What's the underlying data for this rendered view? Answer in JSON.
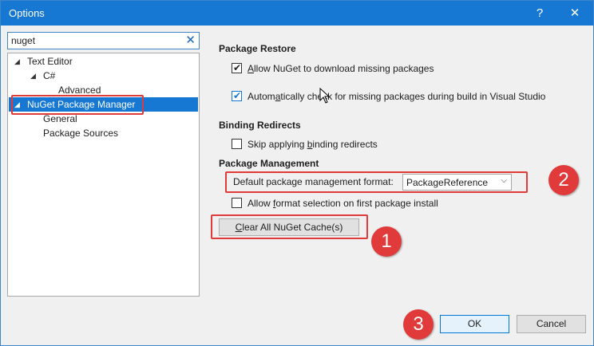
{
  "window": {
    "title": "Options",
    "help_glyph": "?",
    "close_glyph": "✕"
  },
  "search": {
    "value": "nuget",
    "clear_glyph": "✕"
  },
  "tree": {
    "items": [
      {
        "label": "Text Editor",
        "arrow": "◢"
      },
      {
        "label": "C#",
        "arrow": "◢"
      },
      {
        "label": "Advanced",
        "arrow": ""
      },
      {
        "label": "NuGet Package Manager",
        "arrow": "◢"
      },
      {
        "label": "General",
        "arrow": ""
      },
      {
        "label": "Package Sources",
        "arrow": ""
      }
    ]
  },
  "restore": {
    "heading": "Package Restore",
    "allow_download": {
      "pre": "",
      "u": "A",
      "post": "llow NuGet to download missing packages",
      "checked": true
    },
    "auto_check": {
      "pre": "Autom",
      "u": "a",
      "post": "tically check for missing packages during build in Visual Studio",
      "checked": true
    }
  },
  "binding": {
    "heading": "Binding Redirects",
    "skip": {
      "pre": "Skip applying ",
      "u": "b",
      "post": "inding redirects",
      "checked": false
    }
  },
  "management": {
    "heading": "Package Management",
    "format_label": "Default package management format:",
    "format_value": "PackageReference",
    "allow_format": {
      "pre": "Allow ",
      "u": "f",
      "post": "ormat selection on first package install",
      "checked": false
    },
    "clear_cache": {
      "u": "C",
      "post": "lear All NuGet Cache(s)"
    }
  },
  "footer": {
    "ok": "OK",
    "cancel": "Cancel"
  },
  "badges": {
    "one": "1",
    "two": "2",
    "three": "3"
  },
  "colors": {
    "accent": "#1778d3",
    "highlight": "#e03a3a"
  }
}
